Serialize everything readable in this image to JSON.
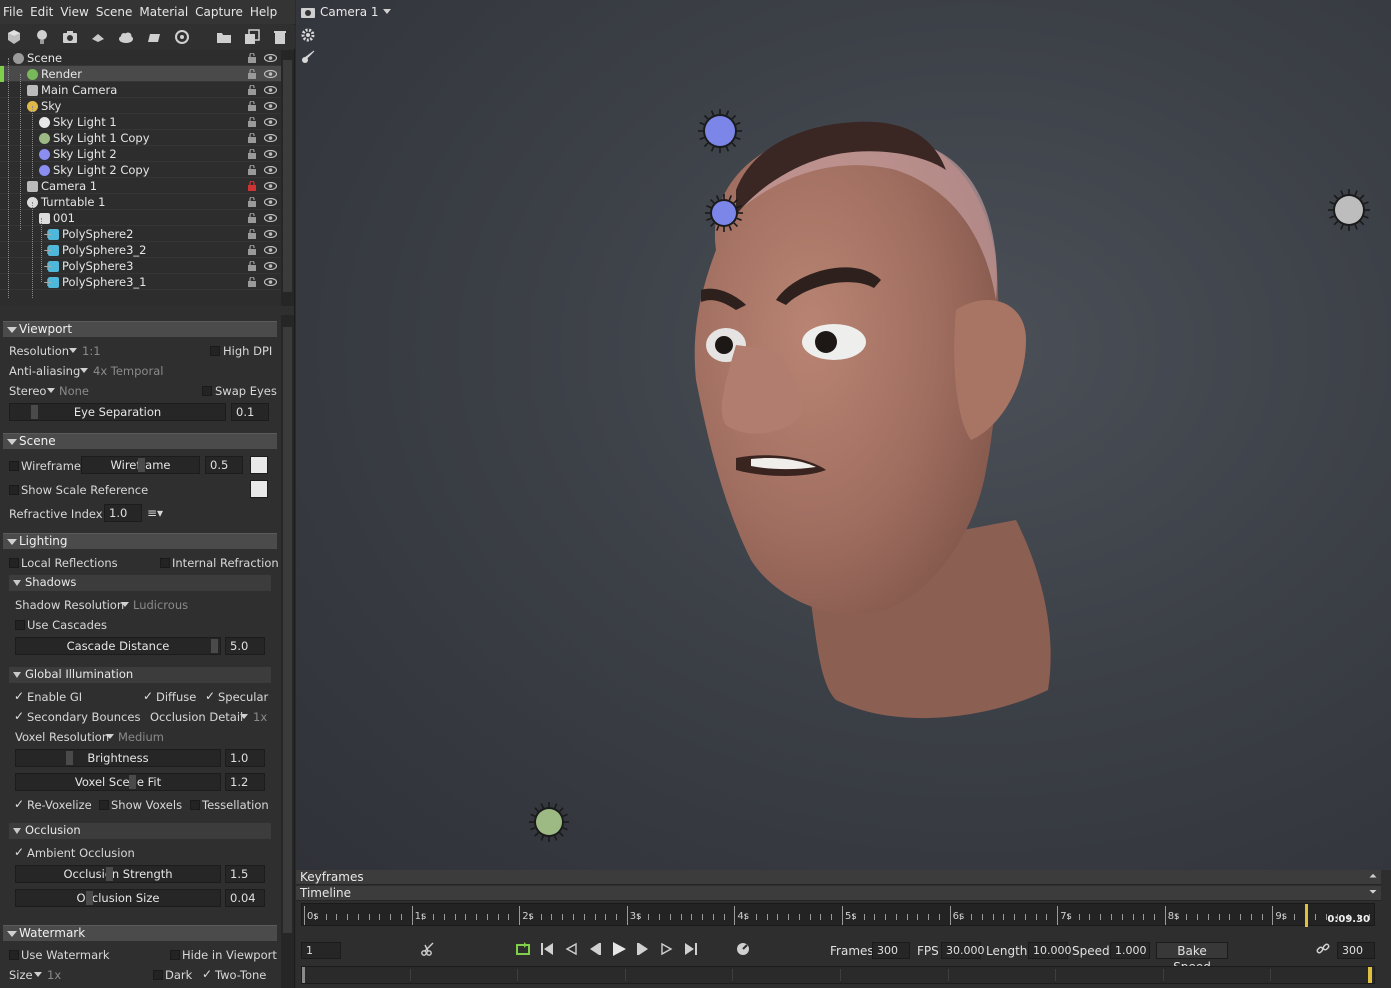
{
  "menu": [
    "File",
    "Edit",
    "View",
    "Scene",
    "Material",
    "Capture",
    "Help"
  ],
  "toolbar_icons": [
    "cube-icon",
    "bulb-icon",
    "camera-icon",
    "turntable-icon",
    "cloud-icon",
    "shadow-catcher-icon",
    "audio-icon",
    "folder-icon",
    "duplicate-icon",
    "trash-icon"
  ],
  "tree": [
    {
      "label": "Scene",
      "depth": 0,
      "icon": "scene-icon",
      "color": "#9a9a9a",
      "locked": false,
      "selected": false
    },
    {
      "label": "Render",
      "depth": 1,
      "icon": "render-icon",
      "color": "#78b85a",
      "locked": false,
      "selected": true
    },
    {
      "label": "Main Camera",
      "depth": 1,
      "icon": "camera-icon",
      "color": "#bbbbbb",
      "locked": false,
      "selected": false
    },
    {
      "label": "Sky",
      "depth": 1,
      "icon": "sky-icon",
      "color": "#e0b84a",
      "locked": false,
      "selected": false
    },
    {
      "label": "Sky Light 1",
      "depth": 2,
      "icon": "light-icon",
      "color": "#e8e8e8",
      "locked": false,
      "selected": false
    },
    {
      "label": "Sky Light 1 Copy",
      "depth": 2,
      "icon": "light-icon",
      "color": "#9dba85",
      "locked": false,
      "selected": false
    },
    {
      "label": "Sky Light 2",
      "depth": 2,
      "icon": "light-icon",
      "color": "#8a8ef0",
      "locked": false,
      "selected": false
    },
    {
      "label": "Sky Light 2 Copy",
      "depth": 2,
      "icon": "light-icon",
      "color": "#8a8ef0",
      "locked": false,
      "selected": false
    },
    {
      "label": "Camera 1",
      "depth": 1,
      "icon": "camera-icon",
      "color": "#bbbbbb",
      "locked": true,
      "selected": false
    },
    {
      "label": "Turntable 1",
      "depth": 1,
      "icon": "turntable-icon",
      "color": "#dddddd",
      "locked": false,
      "selected": false
    },
    {
      "label": "001",
      "depth": 2,
      "icon": "group-icon",
      "color": "#dddddd",
      "locked": false,
      "selected": false
    },
    {
      "label": "PolySphere2",
      "depth": 3,
      "icon": "mesh-icon",
      "color": "#4fb7d8",
      "locked": false,
      "selected": false
    },
    {
      "label": "PolySphere3_2",
      "depth": 3,
      "icon": "mesh-icon",
      "color": "#4fb7d8",
      "locked": false,
      "selected": false
    },
    {
      "label": "PolySphere3",
      "depth": 3,
      "icon": "mesh-icon",
      "color": "#4fb7d8",
      "locked": false,
      "selected": false
    },
    {
      "label": "PolySphere3_1",
      "depth": 3,
      "icon": "mesh-icon",
      "color": "#4fb7d8",
      "locked": false,
      "selected": false
    }
  ],
  "viewport": {
    "camera_label": "Camera 1",
    "resolution_label": "Resolution",
    "resolution_value": "1:1",
    "high_dpi_label": "High DPI",
    "aa_label": "Anti-aliasing",
    "aa_value": "4x Temporal",
    "stereo_label": "Stereo",
    "stereo_value": "None",
    "swap_eyes_label": "Swap Eyes",
    "eye_sep_label": "Eye Separation",
    "eye_sep_value": "0.1",
    "lights": [
      {
        "name": "blue-light-top",
        "color": "#7b86e8"
      },
      {
        "name": "blue-light-mid",
        "color": "#7b86e8"
      },
      {
        "name": "grey-light",
        "color": "#bdbdbd"
      },
      {
        "name": "green-light",
        "color": "#9dba85"
      }
    ]
  },
  "sections": {
    "viewport": "Viewport",
    "scene": "Scene",
    "lighting": "Lighting",
    "shadows": "Shadows",
    "gi": "Global Illumination",
    "occlusion": "Occlusion",
    "watermark": "Watermark"
  },
  "scene": {
    "wireframe_label": "Wireframe",
    "wireframe_slider": "Wireframe",
    "wireframe_value": "0.5",
    "scale_ref_label": "Show Scale Reference",
    "refr_label": "Refractive Index:",
    "refr_value": "1.0"
  },
  "lighting": {
    "local_refl": "Local Reflections",
    "internal_refr": "Internal Refraction",
    "shadow_res_label": "Shadow Resolution",
    "shadow_res_value": "Ludicrous",
    "use_cascades": "Use Cascades",
    "cascade_label": "Cascade Distance",
    "cascade_value": "5.0",
    "enable_gi": "Enable GI",
    "diffuse": "Diffuse",
    "specular": "Specular",
    "secondary": "Secondary Bounces",
    "occ_detail_label": "Occlusion Detail",
    "occ_detail_value": "1x",
    "voxel_res_label": "Voxel Resolution",
    "voxel_res_value": "Medium",
    "brightness_label": "Brightness",
    "brightness_value": "1.0",
    "voxel_fit_label": "Voxel Scene Fit",
    "voxel_fit_value": "1.2",
    "revoxelize": "Re-Voxelize",
    "show_voxels": "Show Voxels",
    "tessellation": "Tessellation"
  },
  "occlusion": {
    "ambient": "Ambient Occlusion",
    "strength_label": "Occlusion Strength",
    "strength_value": "1.5",
    "size_label": "Occlusion Size",
    "size_value": "0.04"
  },
  "watermark": {
    "use": "Use Watermark",
    "hide": "Hide in Viewport",
    "size_label": "Size",
    "size_value": "1x",
    "dark": "Dark",
    "two_tone": "Two-Tone"
  },
  "timeline": {
    "keyframes_label": "Keyframes",
    "timeline_label": "Timeline",
    "ticks": [
      "0s",
      "1s",
      "2s",
      "3s",
      "4s",
      "5s",
      "6s",
      "7s",
      "8s",
      "9s"
    ],
    "current_time": "0:09.30",
    "frame_value": "1",
    "frames_label": "Frames",
    "frames_value": "300",
    "fps_label": "FPS",
    "fps_value": "30.000",
    "length_label": "Length",
    "length_value": "10.000",
    "speed_label": "Speed",
    "speed_value": "1.000",
    "bake_speed_label": "Bake Speed",
    "end_frame_value": "300",
    "playhead_fraction": 0.93
  }
}
